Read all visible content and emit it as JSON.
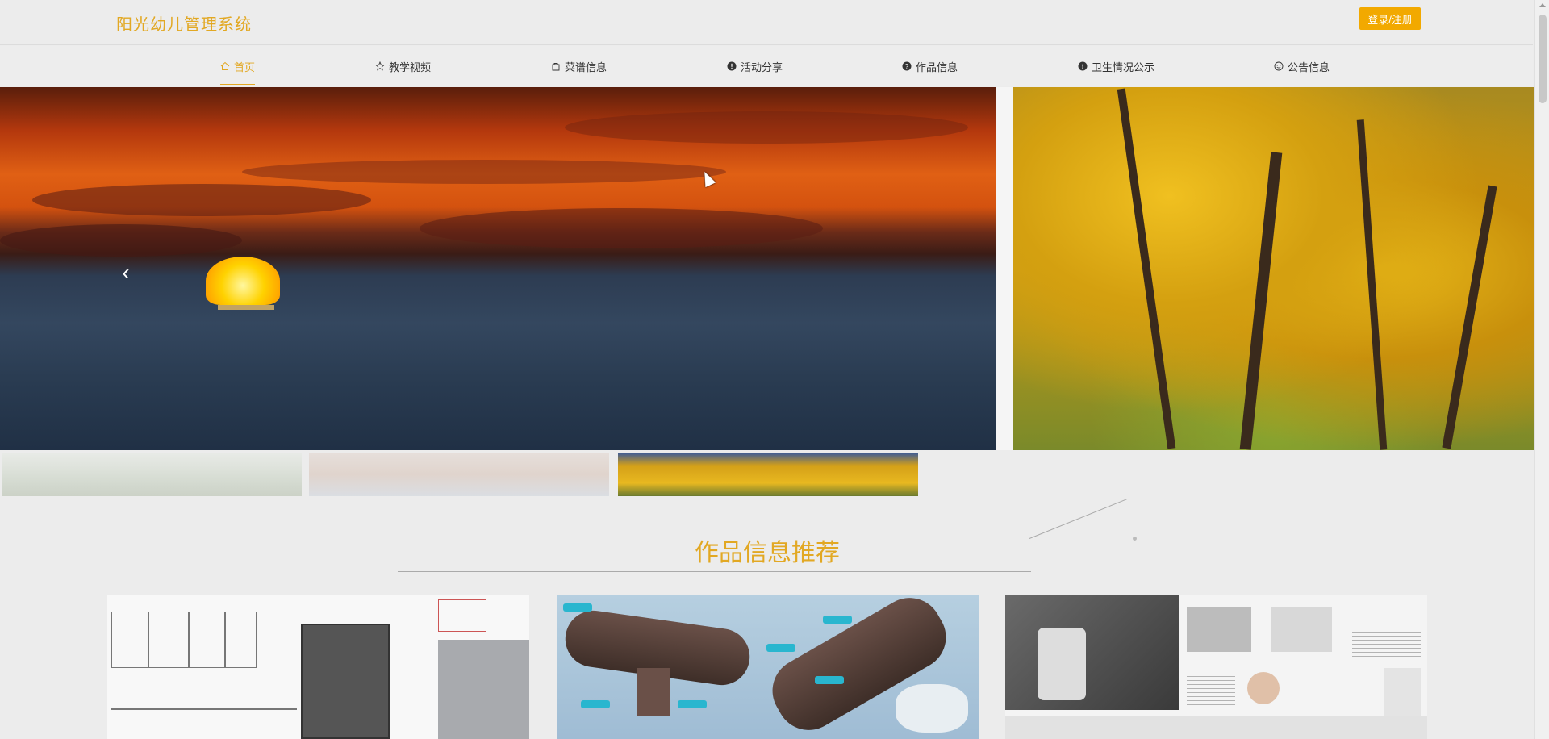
{
  "header": {
    "title": "阳光幼儿管理系统",
    "login_label": "登录/注册"
  },
  "nav": {
    "items": [
      {
        "label": "首页",
        "icon": "home-icon",
        "active": true
      },
      {
        "label": "教学视频",
        "icon": "star-icon",
        "active": false
      },
      {
        "label": "菜谱信息",
        "icon": "bag-icon",
        "active": false
      },
      {
        "label": "活动分享",
        "icon": "alert-circle-icon",
        "active": false
      },
      {
        "label": "作品信息",
        "icon": "question-circle-icon",
        "active": false
      },
      {
        "label": "卫生情况公示",
        "icon": "info-circle-icon",
        "active": false
      },
      {
        "label": "公告信息",
        "icon": "smile-icon",
        "active": false
      }
    ]
  },
  "carousel": {
    "prev_arrow": "‹"
  },
  "section": {
    "title": "作品信息推荐"
  },
  "colors": {
    "accent": "#e2a823",
    "button": "#f2a900"
  }
}
